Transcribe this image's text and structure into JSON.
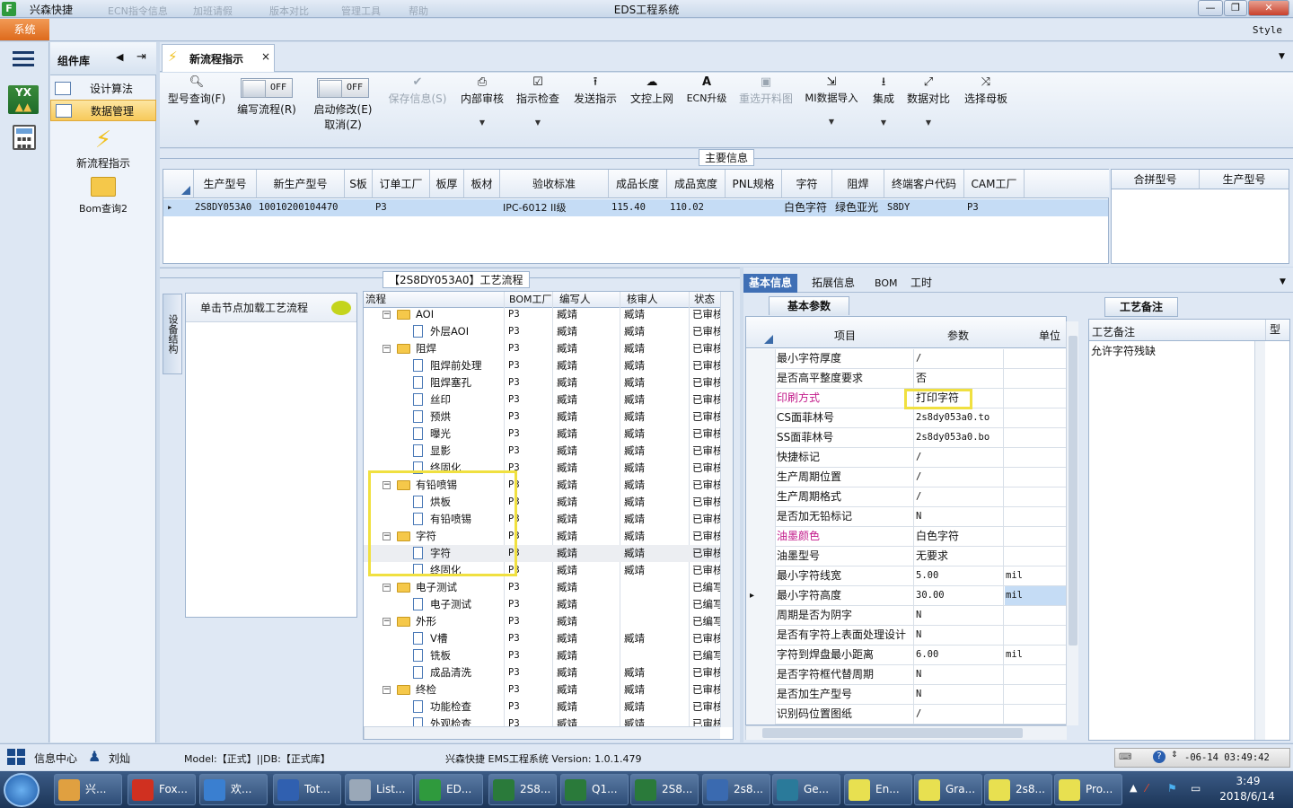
{
  "title_bar": {
    "app_name": "兴森快捷",
    "blurred_items": [
      "ECN指令信息",
      "加班请假",
      "版本对比",
      "管理工具",
      "帮助"
    ],
    "window_title": "EDS工程系统",
    "min": "—",
    "max": "❐",
    "close": "✕"
  },
  "menubar": {
    "system": "系统",
    "style": "Style"
  },
  "component_panel": {
    "title": "组件库",
    "items": [
      {
        "label": "设计算法",
        "selected": false
      },
      {
        "label": "数据管理",
        "selected": true
      }
    ],
    "tools": [
      "新流程指示",
      "Bom查询2"
    ]
  },
  "doc_tab": {
    "label": "新流程指示",
    "close": "×"
  },
  "ribbon": {
    "buttons": [
      {
        "icon": "search-icon",
        "label": "型号查询(F)",
        "enabled": true
      },
      {
        "icon": "toggle-off",
        "label": "编写流程(R)",
        "toggle": "OFF",
        "enabled": true
      },
      {
        "icon": "toggle-off",
        "label": "启动修改(E)",
        "sub": "取消(Z)",
        "toggle": "OFF",
        "enabled": true
      },
      {
        "icon": "check-icon",
        "label": "保存信息(S)",
        "enabled": false
      },
      {
        "icon": "print-icon",
        "label": "内部审核",
        "enabled": true
      },
      {
        "icon": "check-box-icon",
        "label": "指示检查",
        "enabled": true
      },
      {
        "icon": "upload-icon",
        "label": "发送指示",
        "enabled": true
      },
      {
        "icon": "cloud-upload-icon",
        "label": "文控上网",
        "enabled": true
      },
      {
        "icon": "ecn-icon",
        "label": "ECN升级",
        "enabled": true
      },
      {
        "icon": "image-icon",
        "label": "重选开料图",
        "enabled": false
      },
      {
        "icon": "import-icon",
        "label": "MI数据导入",
        "enabled": true
      },
      {
        "icon": "download-icon",
        "label": "集成",
        "enabled": true
      },
      {
        "icon": "compare-icon",
        "label": "数据对比",
        "enabled": true
      },
      {
        "icon": "shuffle-icon",
        "label": "选择母板",
        "enabled": true
      }
    ]
  },
  "main_info": {
    "section_title": "主要信息",
    "columns": [
      "生产型号",
      "新生产型号",
      "S板",
      "订单工厂",
      "板厚",
      "板材",
      "验收标准",
      "成品长度",
      "成品宽度",
      "PNL规格",
      "字符",
      "阻焊",
      "终端客户代码",
      "CAM工厂"
    ],
    "row": [
      "2S8DY053A0",
      "10010200104470",
      "",
      "P3",
      "",
      "",
      "IPC-6012 II级",
      "115.40",
      "110.02",
      "",
      "白色字符",
      "绿色亚光",
      "S8DY",
      "P3"
    ],
    "side_columns": [
      "合拼型号",
      "生产型号"
    ]
  },
  "flow": {
    "section_title": "【2S8DY053A0】工艺流程",
    "side_tab": "设备结构",
    "node_hint": "单击节点加载工艺流程",
    "columns": [
      "流程",
      "BOM工厂",
      "编写人",
      "核审人",
      "状态"
    ],
    "rows": [
      {
        "level": 1,
        "type": "folder",
        "name": "AOI",
        "bom": "P3",
        "writer": "臧靖",
        "checker": "臧靖",
        "status": "已审核"
      },
      {
        "level": 2,
        "type": "doc",
        "name": "外层AOI",
        "bom": "P3",
        "writer": "臧靖",
        "checker": "臧靖",
        "status": "已审核"
      },
      {
        "level": 1,
        "type": "folder",
        "name": "阻焊",
        "bom": "P3",
        "writer": "臧靖",
        "checker": "臧靖",
        "status": "已审核"
      },
      {
        "level": 2,
        "type": "doc",
        "name": "阻焊前处理",
        "bom": "P3",
        "writer": "臧靖",
        "checker": "臧靖",
        "status": "已审核"
      },
      {
        "level": 2,
        "type": "doc",
        "name": "阻焊塞孔",
        "bom": "P3",
        "writer": "臧靖",
        "checker": "臧靖",
        "status": "已审核"
      },
      {
        "level": 2,
        "type": "doc",
        "name": "丝印",
        "bom": "P3",
        "writer": "臧靖",
        "checker": "臧靖",
        "status": "已审核"
      },
      {
        "level": 2,
        "type": "doc",
        "name": "预烘",
        "bom": "P3",
        "writer": "臧靖",
        "checker": "臧靖",
        "status": "已审核"
      },
      {
        "level": 2,
        "type": "doc",
        "name": "曝光",
        "bom": "P3",
        "writer": "臧靖",
        "checker": "臧靖",
        "status": "已审核"
      },
      {
        "level": 2,
        "type": "doc",
        "name": "显影",
        "bom": "P3",
        "writer": "臧靖",
        "checker": "臧靖",
        "status": "已审核"
      },
      {
        "level": 2,
        "type": "doc",
        "name": "终固化",
        "bom": "P3",
        "writer": "臧靖",
        "checker": "臧靖",
        "status": "已审核"
      },
      {
        "level": 1,
        "type": "folder",
        "name": "有铅喷锡",
        "bom": "P3",
        "writer": "臧靖",
        "checker": "臧靖",
        "status": "已审核"
      },
      {
        "level": 2,
        "type": "doc",
        "name": "烘板",
        "bom": "P3",
        "writer": "臧靖",
        "checker": "臧靖",
        "status": "已审核"
      },
      {
        "level": 2,
        "type": "doc",
        "name": "有铅喷锡",
        "bom": "P3",
        "writer": "臧靖",
        "checker": "臧靖",
        "status": "已审核"
      },
      {
        "level": 1,
        "type": "folder",
        "name": "字符",
        "bom": "P3",
        "writer": "臧靖",
        "checker": "臧靖",
        "status": "已审核"
      },
      {
        "level": 2,
        "type": "doc",
        "name": "字符",
        "bom": "P3",
        "writer": "臧靖",
        "checker": "臧靖",
        "status": "已审核",
        "selected": true
      },
      {
        "level": 2,
        "type": "doc",
        "name": "终固化",
        "bom": "P3",
        "writer": "臧靖",
        "checker": "臧靖",
        "status": "已审核"
      },
      {
        "level": 1,
        "type": "folder",
        "name": "电子测试",
        "bom": "P3",
        "writer": "臧靖",
        "checker": "",
        "status": "已编写"
      },
      {
        "level": 2,
        "type": "doc",
        "name": "电子测试",
        "bom": "P3",
        "writer": "臧靖",
        "checker": "",
        "status": "已编写"
      },
      {
        "level": 1,
        "type": "folder",
        "name": "外形",
        "bom": "P3",
        "writer": "臧靖",
        "checker": "",
        "status": "已编写"
      },
      {
        "level": 2,
        "type": "doc",
        "name": "V槽",
        "bom": "P3",
        "writer": "臧靖",
        "checker": "臧靖",
        "status": "已审核"
      },
      {
        "level": 2,
        "type": "doc",
        "name": "铣板",
        "bom": "P3",
        "writer": "臧靖",
        "checker": "",
        "status": "已编写"
      },
      {
        "level": 2,
        "type": "doc",
        "name": "成品清洗",
        "bom": "P3",
        "writer": "臧靖",
        "checker": "臧靖",
        "status": "已审核"
      },
      {
        "level": 1,
        "type": "folder",
        "name": "终检",
        "bom": "P3",
        "writer": "臧靖",
        "checker": "臧靖",
        "status": "已审核"
      },
      {
        "level": 2,
        "type": "doc",
        "name": "功能检查",
        "bom": "P3",
        "writer": "臧靖",
        "checker": "臧靖",
        "status": "已审核"
      },
      {
        "level": 2,
        "type": "doc",
        "name": "外观检查",
        "bom": "P3",
        "writer": "臧靖",
        "checker": "臧靖",
        "status": "已审核"
      }
    ]
  },
  "detail_tabs": [
    "基本信息",
    "拓展信息",
    "BOM",
    "工时"
  ],
  "basic_params": {
    "tab": "基本参数",
    "columns": [
      "项目",
      "参数",
      "单位"
    ],
    "rows": [
      {
        "item": "最小字符厚度",
        "value": "/",
        "unit": ""
      },
      {
        "item": "是否高平整度要求",
        "value": "否",
        "unit": ""
      },
      {
        "item": "印刷方式",
        "value": "打印字符",
        "unit": "",
        "pink": true
      },
      {
        "item": "CS面菲林号",
        "value": "2s8dy053a0.to",
        "unit": ""
      },
      {
        "item": "SS面菲林号",
        "value": "2s8dy053a0.bo",
        "unit": ""
      },
      {
        "item": "快捷标记",
        "value": "/",
        "unit": ""
      },
      {
        "item": "生产周期位置",
        "value": "/",
        "unit": ""
      },
      {
        "item": "生产周期格式",
        "value": "/",
        "unit": ""
      },
      {
        "item": "是否加无铅标记",
        "value": "N",
        "unit": ""
      },
      {
        "item": "油墨颜色",
        "value": "白色字符",
        "unit": "",
        "pink": true
      },
      {
        "item": "油墨型号",
        "value": "无要求",
        "unit": ""
      },
      {
        "item": "最小字符线宽",
        "value": "5.00",
        "unit": "mil"
      },
      {
        "item": "最小字符高度",
        "value": "30.00",
        "unit": "mil",
        "current": true
      },
      {
        "item": "周期是否为阴字",
        "value": "N",
        "unit": ""
      },
      {
        "item": "是否有字符上表面处理设计",
        "value": "N",
        "unit": ""
      },
      {
        "item": "字符到焊盘最小距离",
        "value": "6.00",
        "unit": "mil"
      },
      {
        "item": "是否字符框代替周期",
        "value": "N",
        "unit": ""
      },
      {
        "item": "是否加生产型号",
        "value": "N",
        "unit": ""
      },
      {
        "item": "识别码位置图纸",
        "value": "/",
        "unit": ""
      }
    ]
  },
  "notes": {
    "tab": "工艺备注",
    "column": "工艺备注",
    "column2": "型",
    "text": "允许字符残缺"
  },
  "status_bar": {
    "info_center": "信息中心",
    "user": "刘灿",
    "model_db": "Model:【正式】||DB:【正式库】",
    "system": "兴森快捷 EMS工程系统 Version: 1.0.1.479",
    "datetime": "-06-14 03:49:42"
  },
  "taskbar": {
    "items": [
      {
        "label": "兴...",
        "color": "#e0a040"
      },
      {
        "label": "Fox...",
        "color": "#d03020"
      },
      {
        "label": "欢...",
        "color": "#3a7fd0"
      },
      {
        "label": "Tot...",
        "color": "#3060b0"
      },
      {
        "label": "List...",
        "color": "#9aa8b8"
      },
      {
        "label": "ED...",
        "color": "#2f9a3d"
      },
      {
        "label": "2S8...",
        "color": "#2a7a3a"
      },
      {
        "label": "Q1...",
        "color": "#2a7a3a"
      },
      {
        "label": "2S8...",
        "color": "#2a7a3a"
      },
      {
        "label": "2s8...",
        "color": "#3a6ab0"
      },
      {
        "label": "Ge...",
        "color": "#2a7a9a"
      },
      {
        "label": "En...",
        "color": "#e8e050"
      },
      {
        "label": "Gra...",
        "color": "#e8e050"
      },
      {
        "label": "2s8...",
        "color": "#e8e050"
      },
      {
        "label": "Pro...",
        "color": "#e8e050"
      }
    ],
    "time": "3:49",
    "date": "2018/6/14"
  }
}
